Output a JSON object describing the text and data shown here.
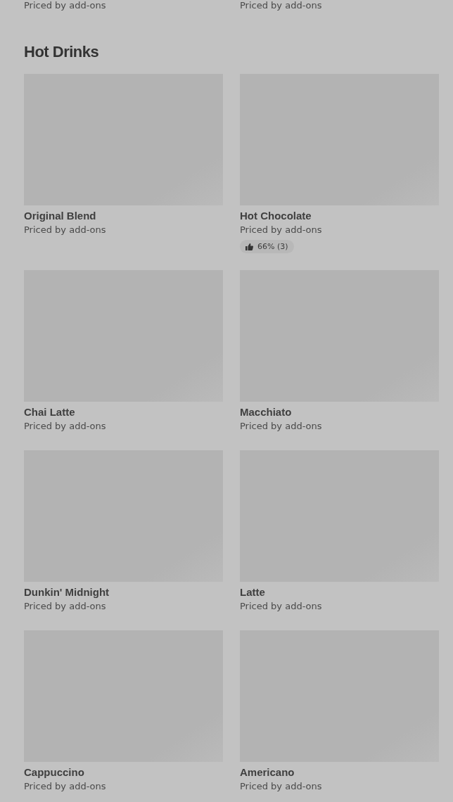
{
  "previous_section": {
    "items": [
      {
        "subtitle": "Priced by add-ons"
      },
      {
        "subtitle": "Priced by add-ons"
      }
    ]
  },
  "section": {
    "title": "Hot Drinks",
    "items": [
      {
        "name": "Original Blend",
        "subtitle": "Priced by add-ons"
      },
      {
        "name": "Hot Chocolate",
        "subtitle": "Priced by add-ons",
        "rating": "66% (3)"
      },
      {
        "name": "Chai Latte",
        "subtitle": "Priced by add-ons"
      },
      {
        "name": "Macchiato",
        "subtitle": "Priced by add-ons"
      },
      {
        "name": "Dunkin' Midnight",
        "subtitle": "Priced by add-ons"
      },
      {
        "name": "Latte",
        "subtitle": "Priced by add-ons"
      },
      {
        "name": "Cappuccino",
        "subtitle": "Priced by add-ons"
      },
      {
        "name": "Americano",
        "subtitle": "Priced by add-ons"
      }
    ]
  }
}
